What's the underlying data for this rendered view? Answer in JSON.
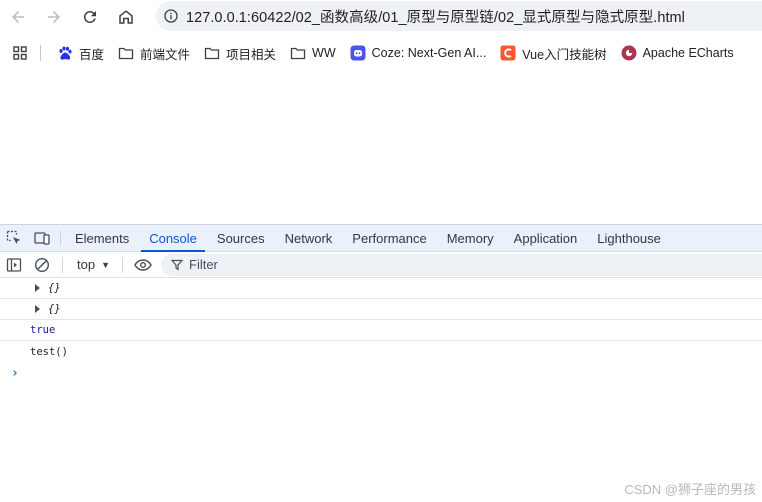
{
  "browser": {
    "url": "127.0.0.1:60422/02_函数高级/01_原型与原型链/02_显式原型与隐式原型.html"
  },
  "bookmarks": {
    "items": [
      {
        "label": "百度",
        "icon": "baidu-paw-icon"
      },
      {
        "label": "前端文件",
        "icon": "folder-icon"
      },
      {
        "label": "项目相关",
        "icon": "folder-icon"
      },
      {
        "label": "WW",
        "icon": "folder-icon"
      },
      {
        "label": "Coze: Next-Gen AI...",
        "icon": "coze-icon"
      },
      {
        "label": "Vue入门技能树",
        "icon": "csdn-c-icon"
      },
      {
        "label": "Apache ECharts",
        "icon": "echarts-icon"
      }
    ]
  },
  "devtools": {
    "tabs": [
      "Elements",
      "Console",
      "Sources",
      "Network",
      "Performance",
      "Memory",
      "Application",
      "Lighthouse"
    ],
    "active_tab": "Console",
    "context": "top",
    "filter_placeholder": "Filter",
    "console_lines": [
      {
        "text": "{}",
        "kind": "object"
      },
      {
        "text": "{}",
        "kind": "object"
      },
      {
        "text": "true",
        "kind": "boolean"
      },
      {
        "text": "test()",
        "kind": "text"
      }
    ],
    "prompt": "›"
  },
  "watermark": "CSDN @狮子座的男孩",
  "colors": {
    "accent": "#0b57d0",
    "devtools_tabbar": "#eaf1fb",
    "omnibox": "#eef1f5"
  }
}
